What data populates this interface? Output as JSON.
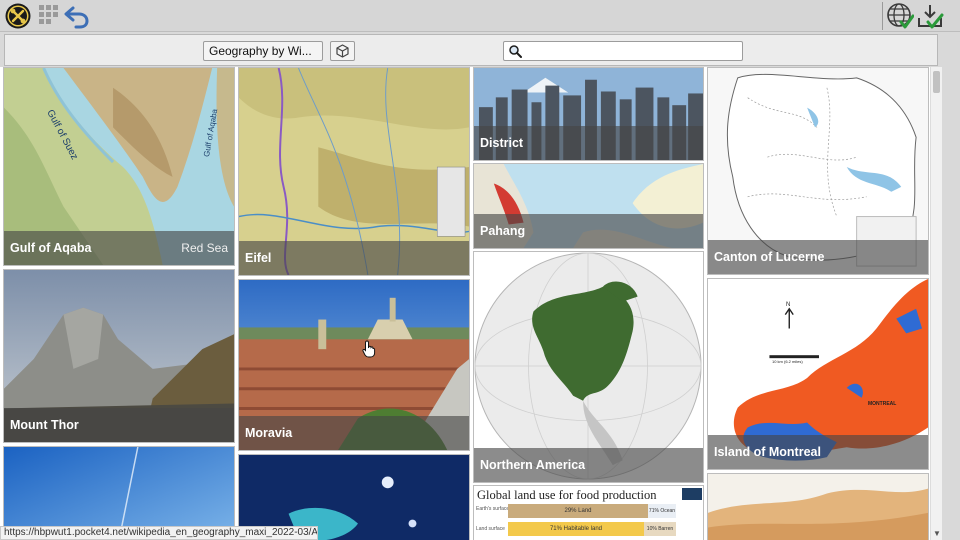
{
  "toolbar": {
    "icons": [
      "tools-circle-icon",
      "grid-dots-icon",
      "undo-arrow-icon",
      "globe-check-icon",
      "download-check-icon"
    ]
  },
  "filter": {
    "selected": "Geography by Wi..."
  },
  "search": {
    "placeholder": "",
    "value": ""
  },
  "tiles": [
    {
      "id": "gulf-of-aqaba",
      "title": "Gulf of Aqaba",
      "subtitle": "Red Sea",
      "map_labels": [
        "Gulf of Suez",
        "Gulf of Aqaba"
      ]
    },
    {
      "id": "mount-thor",
      "title": "Mount Thor"
    },
    {
      "id": "eifel",
      "title": "Eifel"
    },
    {
      "id": "moravia",
      "title": "Moravia"
    },
    {
      "id": "district",
      "title": "District"
    },
    {
      "id": "pahang",
      "title": "Pahang"
    },
    {
      "id": "northern-america",
      "title": "Northern America"
    },
    {
      "id": "global-land-use",
      "title": "Global land use for food production",
      "chart_labels": [
        "29% Land",
        "71% Ocean",
        "71% Habitable land",
        "10% Barren land",
        "Earth's surface",
        "Land surface",
        "Our World in Data"
      ]
    },
    {
      "id": "canton-of-lucerne",
      "title": "Canton of Lucerne"
    },
    {
      "id": "island-of-montreal",
      "title": "Island of Montreal",
      "map_labels": [
        "N",
        "10 km (6.2 miles)",
        "MONTREAL"
      ]
    }
  ],
  "status": {
    "url": "https://hbpwut1.pocket4.net/wikipedia_en_geography_maxi_2022-03/A/Mor..."
  }
}
